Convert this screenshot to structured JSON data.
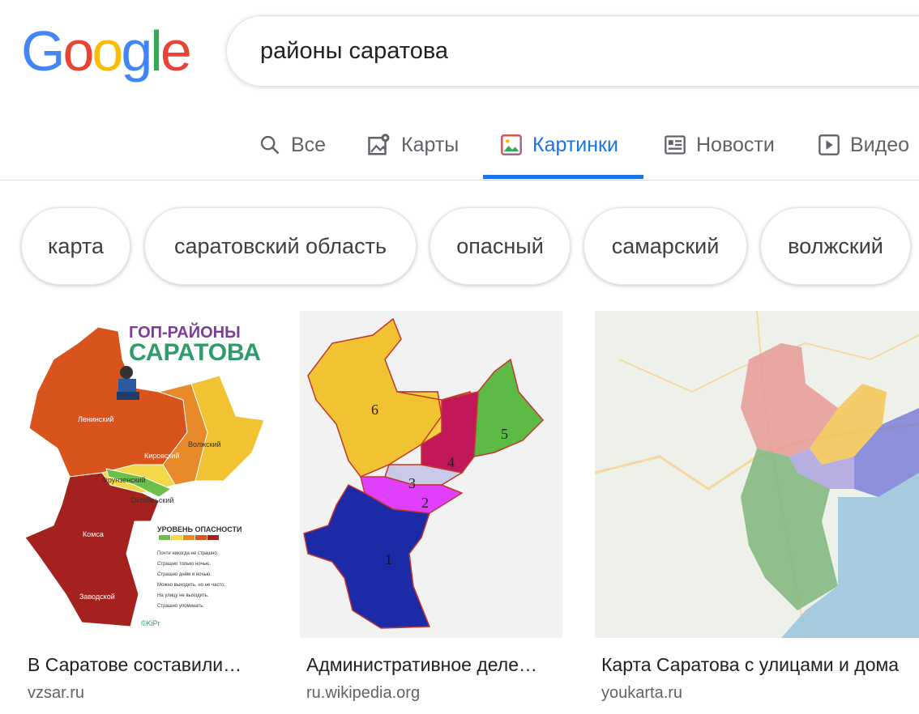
{
  "logo": {
    "letters": [
      "G",
      "o",
      "o",
      "g",
      "l",
      "e"
    ],
    "colors": [
      "#4285F4",
      "#EA4335",
      "#FBBC05",
      "#4285F4",
      "#34A853",
      "#EA4335"
    ]
  },
  "search": {
    "query": "районы саратова"
  },
  "tabs": [
    {
      "label": "Все",
      "icon": "search-icon"
    },
    {
      "label": "Карты",
      "icon": "map-pin-icon"
    },
    {
      "label": "Картинки",
      "icon": "image-icon",
      "active": true
    },
    {
      "label": "Новости",
      "icon": "news-icon"
    },
    {
      "label": "Видео",
      "icon": "video-icon"
    }
  ],
  "chips": [
    "карта",
    "саратовский область",
    "опасный",
    "самарский",
    "волжский"
  ],
  "results": [
    {
      "caption": "В Саратове составили…",
      "source": "vzsar.ru",
      "image_text": {
        "title_1": "ГОП-РАЙОНЫ",
        "title_2": "САРАТОВА",
        "districts": [
          "Ленинский",
          "Кировский",
          "Волжский",
          "Фрунзенский",
          "Октябрьский",
          "Комса",
          "Заводской"
        ],
        "legend_title": "УРОВЕНЬ ОПАСНОСТИ",
        "legend_items": [
          "Почти никогда не страшно.",
          "Страшно только ночью.",
          "Страшно днём и ночью.",
          "Можно выходить, но не часто.",
          "На улицу не выходить.",
          "Страшно упоминать."
        ],
        "watermark": "©KiPr"
      }
    },
    {
      "caption": "Административное деле…",
      "source": "ru.wikipedia.org",
      "image_text": {
        "numbers": [
          "6",
          "5",
          "4",
          "3",
          "2",
          "1"
        ]
      }
    },
    {
      "caption": "Карта Саратова с улицами и дома",
      "source": "youkarta.ru"
    }
  ],
  "colors": {
    "accent": "#1a73e8",
    "tab_inactive": "#5f6368",
    "source": "#5f6368"
  }
}
